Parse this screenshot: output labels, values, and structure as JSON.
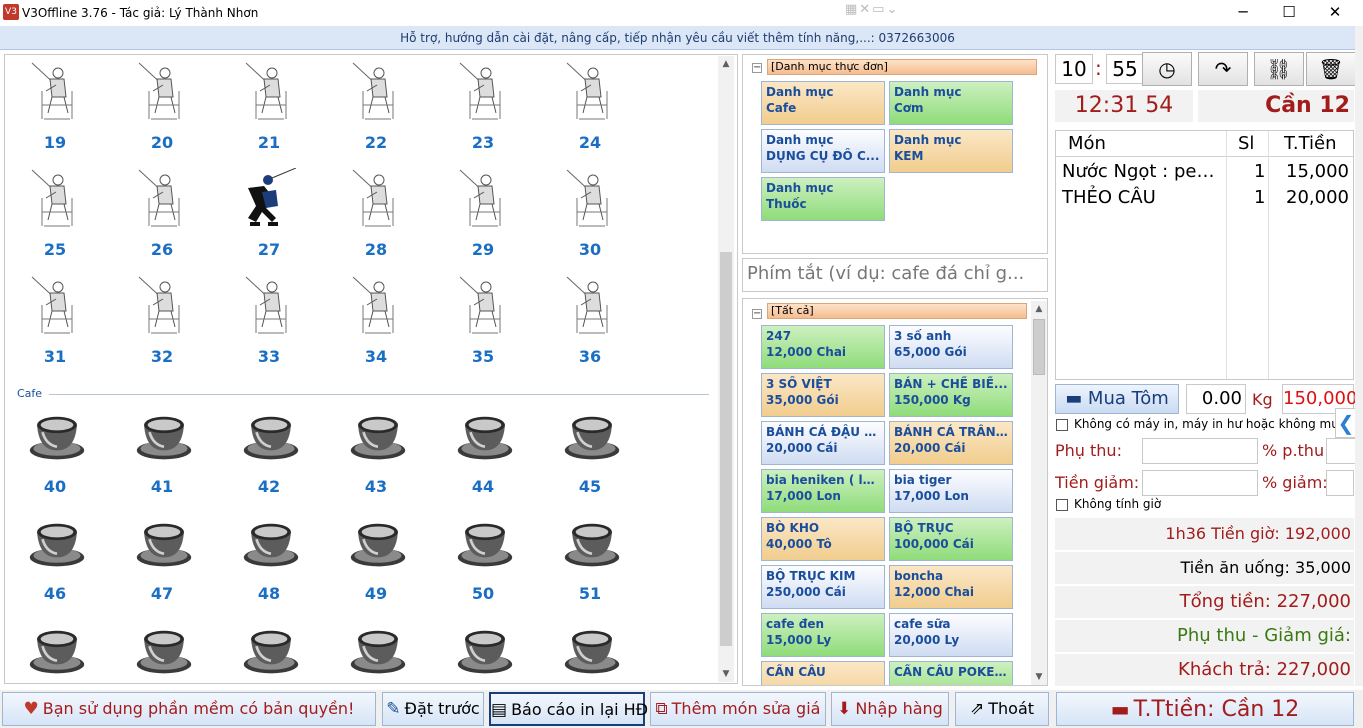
{
  "window": {
    "title": "V3Offline 3.76 - Tác giả: Lý Thành Nhơn",
    "icon": "app-icon",
    "controls": {
      "minimize": "─",
      "maximize": "☐",
      "close": "✕"
    }
  },
  "infobar": {
    "text": "Hỗ trợ, hướng dẫn cài đặt, nâng cấp, tiếp nhận yêu cầu viết thêm tính năng,...: 0372663006"
  },
  "tables": {
    "fishing_tables": [
      {
        "number": "19",
        "occupied": false
      },
      {
        "number": "20",
        "occupied": false
      },
      {
        "number": "21",
        "occupied": false
      },
      {
        "number": "22",
        "occupied": false
      },
      {
        "number": "23",
        "occupied": false
      },
      {
        "number": "24",
        "occupied": false
      },
      {
        "number": "25",
        "occupied": false
      },
      {
        "number": "26",
        "occupied": false
      },
      {
        "number": "27",
        "occupied": true
      },
      {
        "number": "28",
        "occupied": false
      },
      {
        "number": "29",
        "occupied": false
      },
      {
        "number": "30",
        "occupied": false
      },
      {
        "number": "31",
        "occupied": false
      },
      {
        "number": "32",
        "occupied": false
      },
      {
        "number": "33",
        "occupied": false
      },
      {
        "number": "34",
        "occupied": false
      },
      {
        "number": "35",
        "occupied": false
      },
      {
        "number": "36",
        "occupied": false
      }
    ],
    "cafe_section_label": "Cafe",
    "cafe_tables": [
      {
        "number": "40"
      },
      {
        "number": "41"
      },
      {
        "number": "42"
      },
      {
        "number": "43"
      },
      {
        "number": "44"
      },
      {
        "number": "45"
      },
      {
        "number": "46"
      },
      {
        "number": "47"
      },
      {
        "number": "48"
      },
      {
        "number": "49"
      },
      {
        "number": "50"
      },
      {
        "number": "51"
      },
      {
        "number": ""
      },
      {
        "number": ""
      },
      {
        "number": ""
      },
      {
        "number": ""
      },
      {
        "number": ""
      },
      {
        "number": ""
      }
    ]
  },
  "menu_categories": {
    "header": "[Danh mục thực đơn]",
    "items": [
      {
        "line1": "Danh mục",
        "line2": "Cafe",
        "color": "orange"
      },
      {
        "line1": "Danh mục",
        "line2": "Cơm",
        "color": "green"
      },
      {
        "line1": "Danh mục",
        "line2": "DỤNG CỤ ĐỒ C...",
        "color": "blue"
      },
      {
        "line1": "Danh mục",
        "line2": "KEM",
        "color": "orange"
      },
      {
        "line1": "Danh mục",
        "line2": "Thuốc",
        "color": "green"
      }
    ]
  },
  "shortcut": {
    "placeholder": "Phím tắt (ví dụ: cafe đá chỉ g..."
  },
  "items_panel": {
    "header": "[Tất cả]",
    "items": [
      {
        "name": "247",
        "price": "12,000 Chai",
        "color": "green"
      },
      {
        "name": "3 số anh",
        "price": "65,000 Gói",
        "color": "blue"
      },
      {
        "name": "3 SỐ VIỆT",
        "price": "35,000 Gói",
        "color": "orange"
      },
      {
        "name": "BÁN + CHẾ BIẾ...",
        "price": "150,000 Kg",
        "color": "green"
      },
      {
        "name": "BÁNH CÁ ĐẬU ĐỎ",
        "price": "20,000 Cái",
        "color": "blue"
      },
      {
        "name": "BÁNH CÁ TRÂN...",
        "price": "20,000 Cái",
        "color": "orange"
      },
      {
        "name": "bia heniken ( lùn)",
        "price": "17,000 Lon",
        "color": "green"
      },
      {
        "name": "bia tiger",
        "price": "17,000 Lon",
        "color": "blue"
      },
      {
        "name": "BÒ KHO",
        "price": "40,000 Tô",
        "color": "orange"
      },
      {
        "name": "BỘ TRỤC",
        "price": "100,000 Cái",
        "color": "green"
      },
      {
        "name": "BỘ TRỤC KIM",
        "price": "250,000 Cái",
        "color": "blue"
      },
      {
        "name": "boncha",
        "price": "12,000 Chai",
        "color": "orange"
      },
      {
        "name": "cafe đen",
        "price": "15,000 Ly",
        "color": "green"
      },
      {
        "name": "cafe sữa",
        "price": "20,000 Ly",
        "color": "blue"
      },
      {
        "name": "CẦN CÂU",
        "price": "",
        "color": "orange"
      },
      {
        "name": "CẦN CÂU POKE...",
        "price": "",
        "color": "green"
      }
    ]
  },
  "order": {
    "time_hour": "10",
    "time_sep": ":",
    "time_min": "55",
    "toolbar_icons": [
      "clock-icon",
      "forward-arrow-icon",
      "hierarchy-icon",
      "trash-icon"
    ],
    "clock": "12:31 54",
    "table_name": "Cần 12",
    "columns": {
      "item": "Món",
      "qty": "Sl",
      "total": "T.Tiền"
    },
    "lines": [
      {
        "item": "Nước Ngọt : peps...",
        "qty": "1",
        "total": "15,000"
      },
      {
        "item": "THẺO CÂU",
        "qty": "1",
        "total": "20,000"
      }
    ],
    "buy_button": "Mua Tôm",
    "weight": "0.00",
    "weight_unit": "Kg",
    "weight_price": "150,000",
    "no_printer_label": "Không có máy in, máy in hư hoặc không muốn",
    "surcharge_label": "Phụ thu:",
    "surcharge_pct_label": "% p.thu:",
    "discount_label": "Tiền giảm:",
    "discount_pct_label": "% giảm:",
    "no_time_label": "Không tính giờ",
    "time_fee": "1h36 Tiền giờ: 192,000",
    "food_fee": "Tiền ăn uống: 35,000",
    "total": "Tổng tiền: 227,000",
    "surcharge_discount": "Phụ thu - Giảm giá:",
    "customer_pays": "Khách trả: 227,000",
    "side_tab": "❮"
  },
  "bottom": {
    "license": "Bạn sử dụng phần mềm có bản quyền!",
    "reserve": "Đặt trước",
    "report": "Báo cáo in lại HĐ",
    "add_item": "Thêm món sửa giá",
    "import": "Nhập hàng",
    "exit": "Thoát",
    "checkout": "T.Ttiền: Cần 12"
  },
  "colors": {
    "accent_red": "#a31c1c",
    "table_number": "#1a6fc4",
    "info_bg": "#dbe6f7"
  }
}
